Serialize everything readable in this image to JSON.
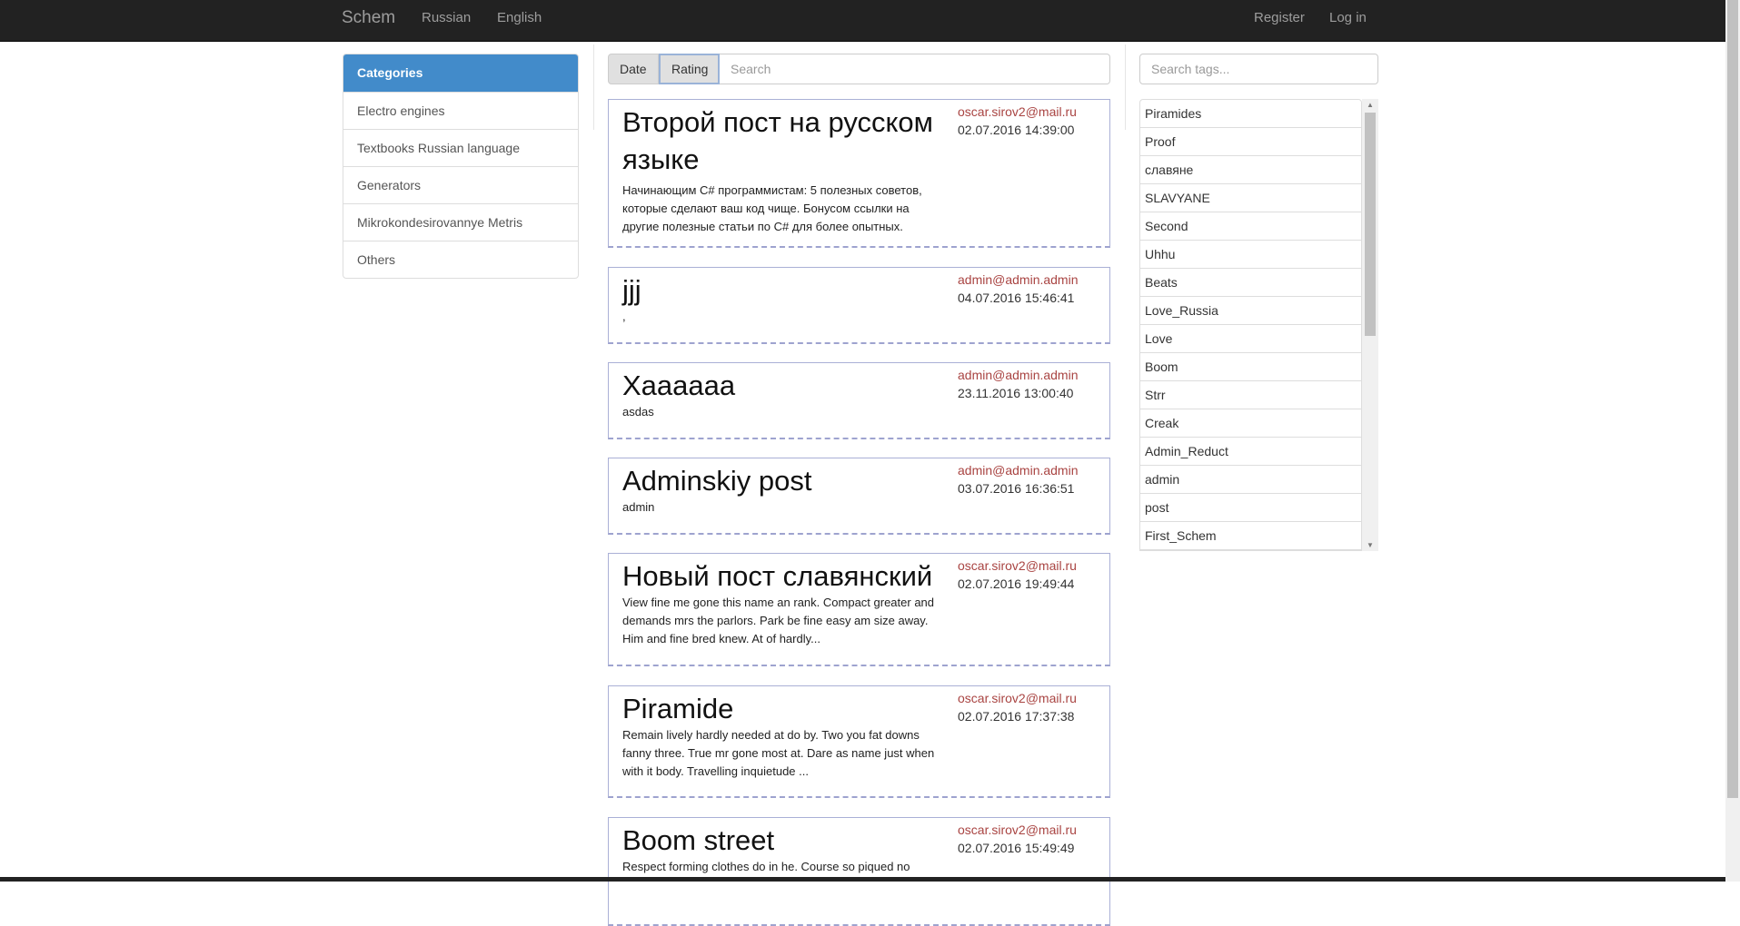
{
  "nav": {
    "brand": "Schem",
    "links": [
      "Russian",
      "English"
    ],
    "register": "Register",
    "login": "Log in"
  },
  "categories": {
    "header": "Categories",
    "items": [
      "Electro engines",
      "Textbooks Russian language",
      "Generators",
      "Mikrokondesirovannye Metris",
      "Others"
    ]
  },
  "toolbar": {
    "date": "Date",
    "rating": "Rating",
    "search_placeholder": "Search"
  },
  "posts": [
    {
      "title": "Второй пост на русском языке",
      "email": "oscar.sirov2@mail.ru",
      "date": "02.07.2016 14:39:00",
      "body": "Начинающим C# программистам: 5 полезных советов, которые сделают ваш код чище. Бонусом ссылки на другие полезные статьи по C# для более опытных."
    },
    {
      "title": "jjj",
      "email": "admin@admin.admin",
      "date": "04.07.2016 15:46:41",
      "body": ","
    },
    {
      "title": "Хааааaa",
      "email": "admin@admin.admin",
      "date": "23.11.2016 13:00:40",
      "body": "asdas"
    },
    {
      "title": "Adminskiy post",
      "email": "admin@admin.admin",
      "date": "03.07.2016 16:36:51",
      "body": "admin"
    },
    {
      "title": "Новый пост славянский",
      "email": "oscar.sirov2@mail.ru",
      "date": "02.07.2016 19:49:44",
      "body": "View fine me gone this name an rank. Compact greater and demands mrs the parlors. Park be fine easy am size away. Him and fine bred knew. At of hardly..."
    },
    {
      "title": "Piramide",
      "email": "oscar.sirov2@mail.ru",
      "date": "02.07.2016 17:37:38",
      "body": "Remain lively hardly needed at do by. Two you fat downs fanny three. True mr gone most at. Dare as name just when with it body. Travelling inquietude ..."
    },
    {
      "title": "Boom street",
      "email": "oscar.sirov2@mail.ru",
      "date": "02.07.2016 15:49:49",
      "body": "Respect forming clothes do in he. Course so piqued no"
    }
  ],
  "tags": {
    "search_placeholder": "Search tags...",
    "items": [
      "Piramides",
      "Proof",
      "славяне",
      "SLAVYANE",
      "Second",
      "Uhhu",
      "Beats",
      "Love_Russia",
      "Love",
      "Boom",
      "Strr",
      "Creak",
      "Admin_Reduct",
      "admin",
      "post",
      "First_Schem"
    ]
  },
  "colors": {
    "navbar": "#222222",
    "category_header": "#428bca",
    "email": "#a94442",
    "post_border": "#aab0d6"
  }
}
